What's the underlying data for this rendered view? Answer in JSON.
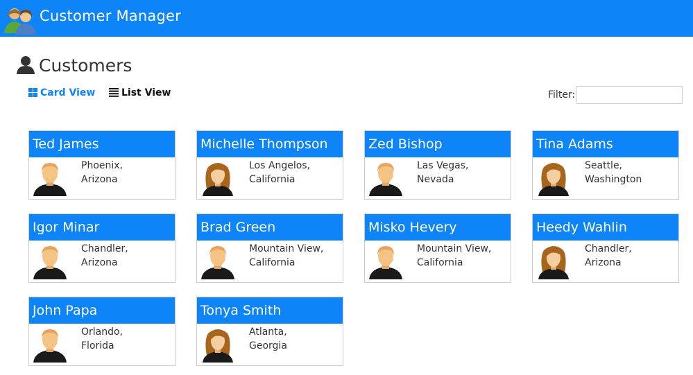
{
  "app": {
    "title": "Customer Manager"
  },
  "page": {
    "title": "Customers"
  },
  "views": {
    "card_label": "Card View",
    "list_label": "List View"
  },
  "filter": {
    "label": "Filter:",
    "value": ""
  },
  "colors": {
    "primary": "#0d84f7",
    "text": "#333333"
  },
  "customers": [
    {
      "name": "Ted James",
      "city": "Phoenix,",
      "state": "Arizona",
      "gender": "male"
    },
    {
      "name": "Michelle Thompson",
      "city": "Los Angelos,",
      "state": "California",
      "gender": "female"
    },
    {
      "name": "Zed Bishop",
      "city": "Las Vegas,",
      "state": "Nevada",
      "gender": "male"
    },
    {
      "name": "Tina Adams",
      "city": "Seattle,",
      "state": "Washington",
      "gender": "female"
    },
    {
      "name": "Igor Minar",
      "city": "Chandler,",
      "state": "Arizona",
      "gender": "male"
    },
    {
      "name": "Brad Green",
      "city": "Mountain View,",
      "state": "California",
      "gender": "male"
    },
    {
      "name": "Misko Hevery",
      "city": "Mountain View,",
      "state": "California",
      "gender": "male"
    },
    {
      "name": "Heedy Wahlin",
      "city": "Chandler,",
      "state": "Arizona",
      "gender": "female"
    },
    {
      "name": "John Papa",
      "city": "Orlando,",
      "state": "Florida",
      "gender": "male"
    },
    {
      "name": "Tonya Smith",
      "city": "Atlanta,",
      "state": "Georgia",
      "gender": "female"
    }
  ]
}
